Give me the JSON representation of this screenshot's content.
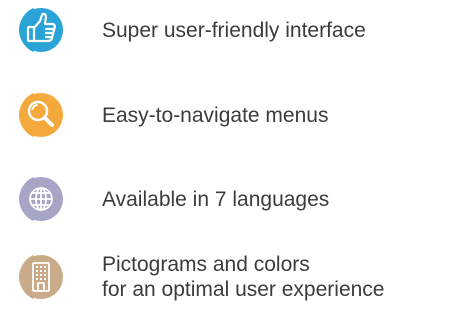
{
  "features": [
    {
      "icon": "thumbs-up-icon",
      "color": "#2aa3d6",
      "label": "Super user-friendly interface"
    },
    {
      "icon": "magnifier-icon",
      "color": "#f3a93c",
      "label": "Easy-to-navigate menus"
    },
    {
      "icon": "globe-icon",
      "color": "#a7a5c6",
      "label": "Available in 7 languages"
    },
    {
      "icon": "building-icon",
      "color": "#c9ab8a",
      "label_lines": [
        "Pictograms and colors",
        "for an optimal user experience"
      ]
    }
  ]
}
